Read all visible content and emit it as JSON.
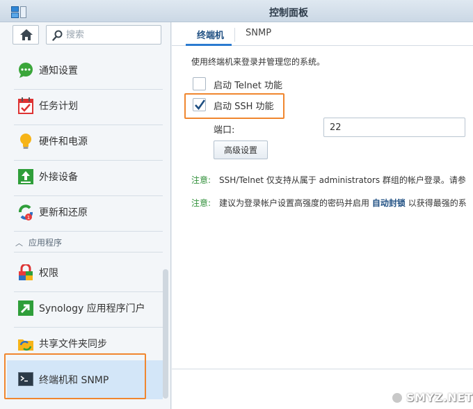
{
  "window": {
    "title": "控制面板"
  },
  "sidebar": {
    "search_placeholder": "搜索",
    "items": [
      {
        "label": "通知设置",
        "icon": "chat-bubble-icon"
      },
      {
        "label": "任务计划",
        "icon": "calendar-check-icon"
      },
      {
        "label": "硬件和电源",
        "icon": "lightbulb-icon"
      },
      {
        "label": "外接设备",
        "icon": "upload-arrow-icon"
      },
      {
        "label": "更新和还原",
        "icon": "refresh-icon",
        "badge": "1"
      }
    ],
    "section_title": "应用程序",
    "app_items": [
      {
        "label": "权限",
        "icon": "lock-icon"
      },
      {
        "label": "Synology 应用程序门户",
        "icon": "portal-arrow-icon"
      },
      {
        "label": "共享文件夹同步",
        "icon": "folder-sync-icon"
      },
      {
        "label": "终端机和 SNMP",
        "icon": "terminal-icon",
        "selected": true
      }
    ]
  },
  "tabs": [
    {
      "label": "终端机",
      "active": true
    },
    {
      "label": "SNMP",
      "active": false
    }
  ],
  "terminal": {
    "description": "使用终端机来登录并管理您的系统。",
    "telnet": {
      "label": "启动 Telnet 功能",
      "checked": false
    },
    "ssh": {
      "label": "启动 SSH 功能",
      "checked": true
    },
    "port_label": "端口:",
    "port_value": "22",
    "advanced_button": "高级设置",
    "notes": [
      {
        "tag": "注意:",
        "text": "SSH/Telnet 仅支持从属于 administrators 群组的帐户登录。请参"
      },
      {
        "tag": "注意:",
        "text_before": "建议为登录帐户设置高强度的密码并启用",
        "link": "自动封锁",
        "text_after": "以获得最强的系"
      }
    ]
  },
  "colors": {
    "accent": "#2b7bd0",
    "highlight": "#f0862e",
    "note_tag": "#2f8f38"
  },
  "watermark": "SMYZ.NET"
}
